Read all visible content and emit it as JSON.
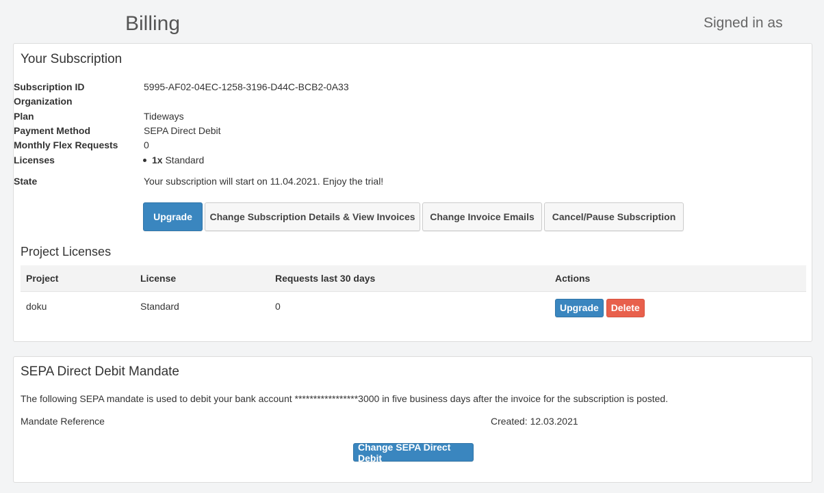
{
  "header": {
    "title": "Billing",
    "signed_in": "Signed in as"
  },
  "subscription": {
    "heading": "Your Subscription",
    "fields": [
      {
        "label": "Subscription ID",
        "value": "5995-AF02-04EC-1258-3196-D44C-BCB2-0A33"
      },
      {
        "label": "Organization",
        "value": ""
      },
      {
        "label": "Plan",
        "value": "Tideways"
      },
      {
        "label": "Payment Method",
        "value": "SEPA Direct Debit"
      },
      {
        "label": "Monthly Flex Requests",
        "value": "0"
      }
    ],
    "licenses": {
      "label": "Licenses",
      "count": "1x",
      "type": "Standard"
    },
    "state": {
      "label": "State",
      "value": "Your subscription will start on 11.04.2021. Enjoy the trial!"
    },
    "buttons": {
      "upgrade": "Upgrade",
      "change_details": "Change Subscription Details & View Invoices",
      "change_emails": "Change Invoice Emails",
      "cancel": "Cancel/Pause Subscription"
    }
  },
  "project_licenses": {
    "heading": "Project Licenses",
    "columns": [
      "Project",
      "License",
      "Requests last 30 days",
      "Actions"
    ],
    "rows": [
      {
        "project": "doku",
        "license": "Standard",
        "requests": "0",
        "upgrade": "Upgrade",
        "delete": "Delete"
      }
    ]
  },
  "sepa": {
    "heading": "SEPA Direct Debit Mandate",
    "text": "The following SEPA mandate is used to debit your bank account *****************3000 in five business days after the invoice for the subscription is posted.",
    "mandate_label": "Mandate Reference",
    "created": "Created: 12.03.2021",
    "change_button": "Change SEPA Direct Debit"
  },
  "colors": {
    "primary": "#3a86bf",
    "danger": "#e8604c",
    "background": "#f3f4f5"
  }
}
